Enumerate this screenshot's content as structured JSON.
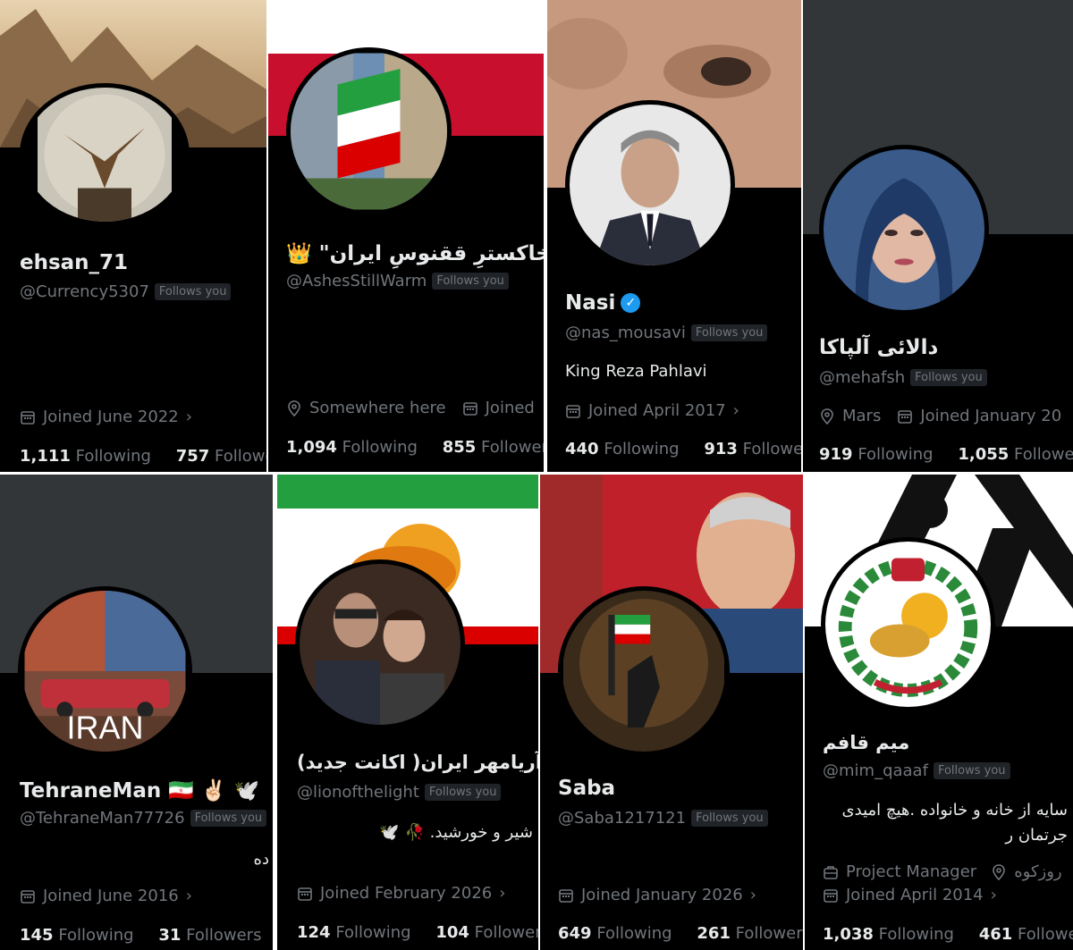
{
  "cards": [
    {
      "name": "ehsan_71",
      "handle": "@Currency5307",
      "follows_you": "Follows you",
      "joined": "Joined June 2022",
      "following_count": "1,111",
      "following_label": "Following",
      "followers_count": "757",
      "followers_label": "Followers"
    },
    {
      "name": "\"خاکسترِ ققنوسِ ایران\" 👑",
      "handle": "@AshesStillWarm",
      "follows_you": "Follows you",
      "location": "Somewhere here",
      "joined": "Joined",
      "following_count": "1,094",
      "following_label": "Following",
      "followers_count": "855",
      "followers_label": "Followers"
    },
    {
      "name": "Nasi",
      "handle": "@nas_mousavi",
      "follows_you": "Follows you",
      "bio": "King Reza Pahlavi",
      "joined": "Joined April 2017",
      "following_count": "440",
      "following_label": "Following",
      "followers_count": "913",
      "followers_label": "Followers"
    },
    {
      "name": "دالائی آلپاکا",
      "handle": "@mehafsh",
      "follows_you": "Follows you",
      "location": "Mars",
      "joined": "Joined January 20",
      "following_count": "919",
      "following_label": "Following",
      "followers_count": "1,055",
      "followers_label": "Followers"
    },
    {
      "name": "TehraneMan 🇮🇷 ✌🏻 🕊️",
      "handle": "@TehraneMan77726",
      "follows_you": "Follows you",
      "bio": "ده",
      "joined": "Joined June 2016",
      "following_count": "145",
      "following_label": "Following",
      "followers_count": "31",
      "followers_label": "Followers",
      "avatar_text": "IRAN"
    },
    {
      "name": "آریامهر ایران( اکانت جدید)",
      "handle": "@lionofthelight",
      "follows_you": "Follows you",
      "bio": "شیر و خورشید. 🥀 🕊️",
      "joined": "Joined February 2026",
      "following_count": "124",
      "following_label": "Following",
      "followers_count": "104",
      "followers_label": "Followers"
    },
    {
      "name": "Saba",
      "handle": "@Saba1217121",
      "follows_you": "Follows you",
      "joined": "Joined January 2026",
      "following_count": "649",
      "following_label": "Following",
      "followers_count": "261",
      "followers_label": "Followers"
    },
    {
      "name": "میم قافم",
      "handle": "@mim_qaaaf",
      "follows_you": "Follows you",
      "bio_line1": "سایه از خانه و خانواده .هیچ امیدی",
      "bio_line2": "جرتمان ر",
      "profession": "Project Manager",
      "location": "روزکوه",
      "joined": "Joined April 2014",
      "following_count": "1,038",
      "following_label": "Following",
      "followers_count": "461",
      "followers_label": "Followers"
    }
  ],
  "colors": {
    "card_bg": "#000000",
    "text": "#e7e9ea",
    "muted": "#71767b",
    "badge_bg": "#202327",
    "verified": "#1d9bf0"
  }
}
